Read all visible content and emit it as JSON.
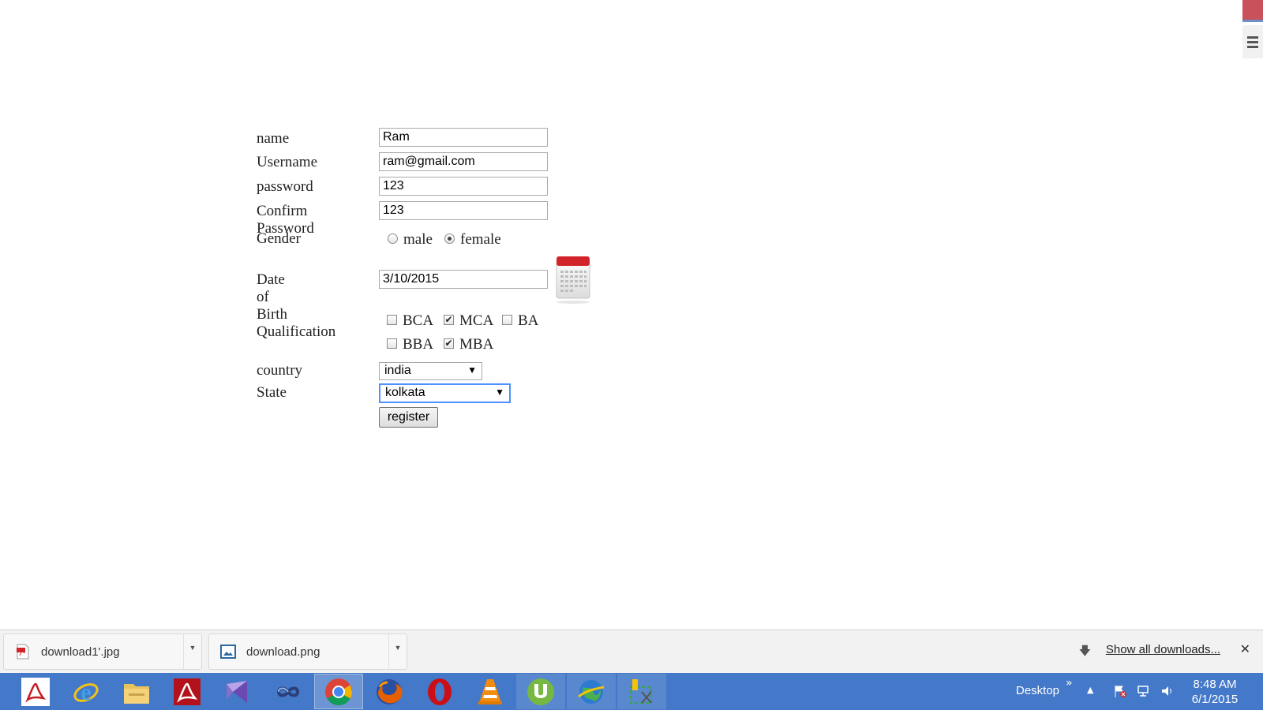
{
  "form": {
    "name_label": "name",
    "name_value": "Ram",
    "username_label": "Username",
    "username_value": "ram@gmail.com",
    "password_label": "password",
    "password_value": "123",
    "confirm_label": "Confirm Password",
    "confirm_value": "123",
    "gender_label": "Gender",
    "gender_options": [
      {
        "label": "male",
        "checked": false
      },
      {
        "label": "female",
        "checked": true
      }
    ],
    "dob_label": "Date of Birth",
    "dob_value": "3/10/2015",
    "qualification_label": "Qualification",
    "qualifications": [
      {
        "label": "BCA",
        "checked": false
      },
      {
        "label": "MCA",
        "checked": true
      },
      {
        "label": "BA",
        "checked": false
      },
      {
        "label": "BBA",
        "checked": false
      },
      {
        "label": "MBA",
        "checked": true
      }
    ],
    "country_label": "country",
    "country_value": "india",
    "state_label": "State",
    "state_value": "kolkata",
    "register_label": "register"
  },
  "downloads": {
    "items": [
      {
        "name": "download1'.jpg",
        "icon": "pdf-file-icon"
      },
      {
        "name": "download.png",
        "icon": "image-file-icon"
      }
    ],
    "show_all_label": "Show all downloads..."
  },
  "taskbar": {
    "apps": [
      "adobe-reader-icon",
      "internet-explorer-icon",
      "file-explorer-icon",
      "adobe-acrobat-icon",
      "visual-studio-icon",
      "infinity-app-icon",
      "chrome-icon",
      "firefox-icon",
      "opera-icon",
      "vlc-icon",
      "utorrent-icon",
      "globe-app-icon",
      "snipping-tool-icon"
    ],
    "desktop_label": "Desktop",
    "time": "8:48 AM",
    "date": "6/1/2015"
  },
  "colors": {
    "taskbar": "#4478c8",
    "focus": "#4d90fe"
  }
}
